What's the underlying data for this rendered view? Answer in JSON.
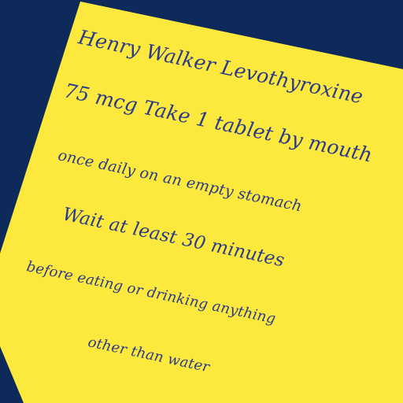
{
  "colors": {
    "background": "#0d2a5a",
    "paper": "#fde93e",
    "ink": "#2a3a8a"
  },
  "note": {
    "lines": [
      "Henry Walker Levothyroxine",
      "75 mcg  Take 1 tablet by mouth",
      "once daily on an empty stomach",
      "Wait at least 30 minutes",
      "before eating or drinking anything",
      "other than water"
    ]
  }
}
